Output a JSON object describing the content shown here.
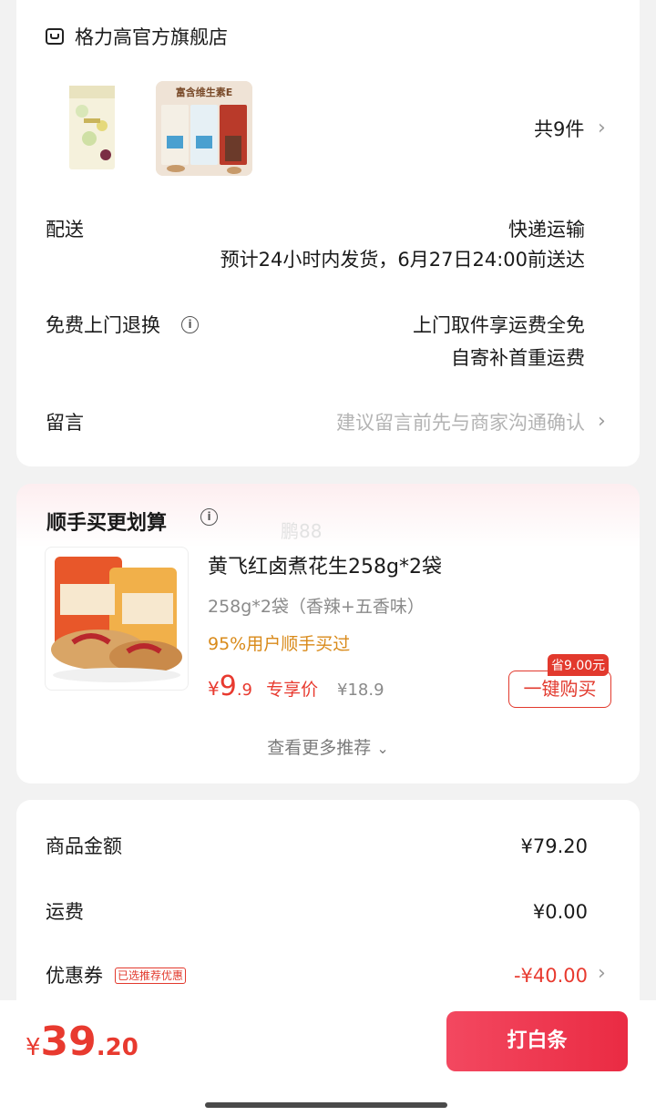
{
  "store": {
    "name": "格力高官方旗舰店",
    "item_count": "共9件",
    "thumb2_banner": "富含维生素E"
  },
  "delivery": {
    "label": "配送",
    "method": "快递运输",
    "estimate": "预计24小时内发货，6月27日24:00前送达"
  },
  "returns": {
    "label": "免费上门退换",
    "line1": "上门取件享运费全免",
    "line2": "自寄补首重运费"
  },
  "message": {
    "label": "留言",
    "placeholder": "建议留言前先与商家沟通确认"
  },
  "recommend": {
    "title": "顺手买更划算",
    "watermark": "鹏88",
    "product_name": "黄飞红卤煮花生258g*2袋",
    "spec": "258g*2袋（香辣+五香味）",
    "social": "95%用户顺手买过",
    "price_symbol": "¥",
    "price_int": "9",
    "price_dec": ".9",
    "price_tag": "专享价",
    "orig_price": "¥18.9",
    "save_tag": "省9.00元",
    "buy_label": "一键购买",
    "more_label": "查看更多推荐"
  },
  "summary": {
    "goods_label": "商品金额",
    "goods_value": "¥79.20",
    "ship_label": "运费",
    "ship_value": "¥0.00",
    "coupon_label": "优惠券",
    "coupon_tag": "已选推荐优惠",
    "coupon_value": "-¥40.00"
  },
  "footer": {
    "currency": "¥",
    "total_int": "39",
    "total_dec": ".20",
    "pay_label": "打白条"
  },
  "colors": {
    "accent": "#e83a2f",
    "pay_button": "#ee3650",
    "orange_text": "#d98a1a"
  }
}
